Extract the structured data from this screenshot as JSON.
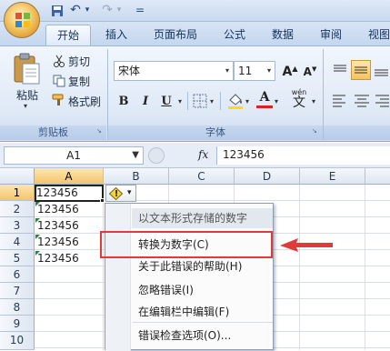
{
  "quick_access": {
    "undo_icon": "↶",
    "redo_icon": "↷",
    "dropdown": "▾",
    "customize": "="
  },
  "tabs": [
    "开始",
    "插入",
    "页面布局",
    "公式",
    "数据",
    "审阅",
    "视图"
  ],
  "ribbon": {
    "clipboard": {
      "cut": "剪切",
      "copy": "复制",
      "paste": "粘贴",
      "format_painter": "格式刷",
      "group": "剪贴板"
    },
    "font": {
      "name": "宋体",
      "size": "11",
      "bold": "B",
      "italic": "I",
      "underline": "U",
      "grow": "A",
      "shrink": "A",
      "phonetic": "wén",
      "phonetic_char": "文",
      "color_letter": "A",
      "group": "字体"
    }
  },
  "formula_bar": {
    "name_box": "A1",
    "fx": "fx",
    "value": "123456"
  },
  "columns": [
    "A",
    "B",
    "C",
    "D",
    "E"
  ],
  "rows": [
    "1",
    "2",
    "3",
    "4",
    "5",
    "6",
    "7",
    "8",
    "9",
    "10"
  ],
  "cells": {
    "A1": "123456",
    "A2": "123456",
    "A3": "123456",
    "A4": "123456",
    "A5": "123456"
  },
  "error_button": {
    "icon": "!"
  },
  "context_menu": {
    "title": "以文本形式存储的数字",
    "items": [
      "转换为数字(C)",
      "关于此错误的帮助(H)",
      "忽略错误(I)",
      "在编辑栏中编辑(F)",
      "错误检查选项(O)..."
    ]
  },
  "colors": {
    "highlight_box": "#e03a3a",
    "arrow": "#e03a3a",
    "error_triangle": "#1f8a3a"
  }
}
